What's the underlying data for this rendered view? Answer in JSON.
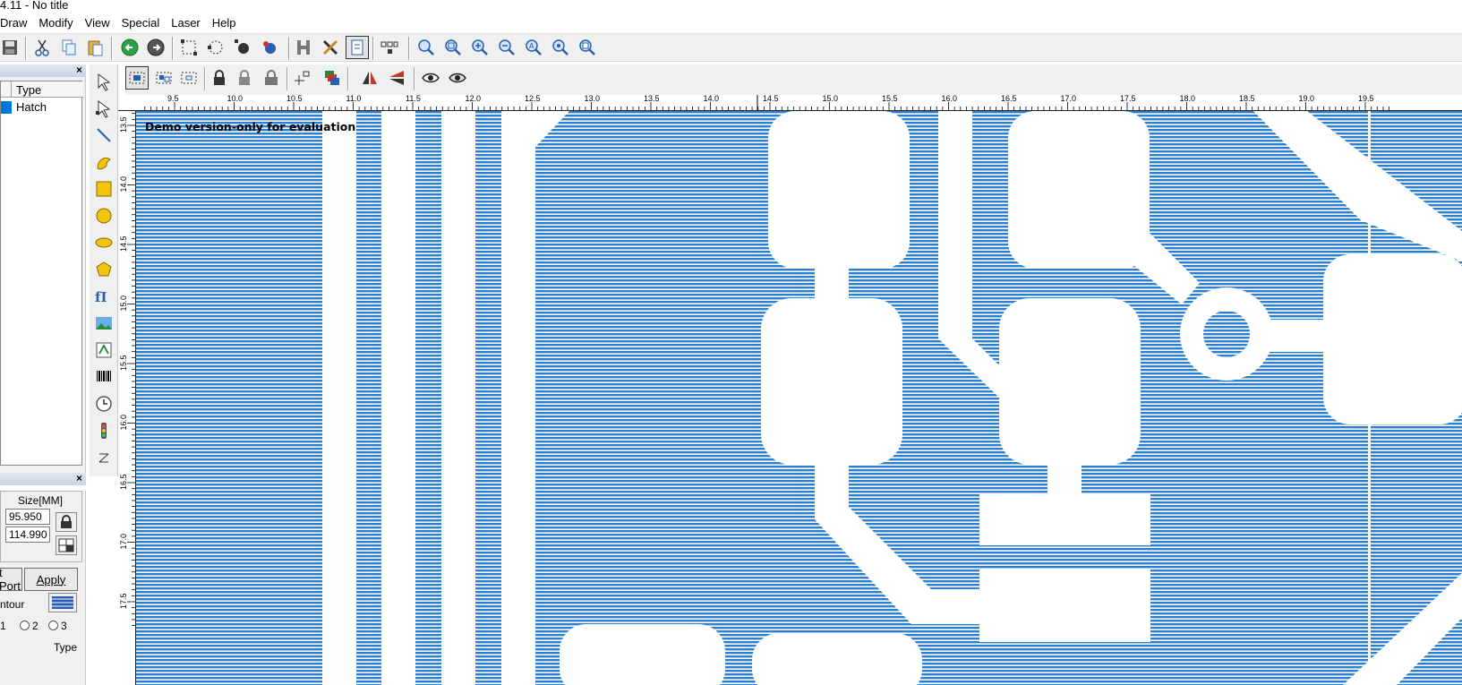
{
  "window": {
    "title": "4.11 - No title"
  },
  "menu": [
    "Draw",
    "Modify",
    "View",
    "Special",
    "Laser",
    "Help"
  ],
  "object_list": {
    "column_header": "Type",
    "rows": [
      {
        "type": "Hatch",
        "color": "#0078d7"
      }
    ]
  },
  "properties": {
    "size_label": "Size[MM]",
    "width": "95.950",
    "height": "114.990",
    "port_button": "t Port",
    "apply_button": "Apply",
    "contour_label": "ntour",
    "radio_labels": [
      "1",
      "2",
      "3"
    ],
    "type_label": "Type"
  },
  "canvas": {
    "watermark": "Demo version-only for evaluation",
    "hatch_color": "#2a7fd0",
    "ruler_h_labels": [
      "9.5",
      "10.0",
      "10.5",
      "11.0",
      "11.5",
      "12.0",
      "12.5",
      "13.0",
      "13.5",
      "14.0",
      "14.5",
      "15.0",
      "15.5",
      "16.0",
      "16.5",
      "17.0",
      "17.5",
      "18.0",
      "18.5",
      "19.0",
      "19.5"
    ],
    "ruler_v_labels": [
      "13.5",
      "14.0",
      "14.5",
      "15.0",
      "15.5",
      "16.0",
      "16.5",
      "17.0",
      "17.5"
    ]
  }
}
